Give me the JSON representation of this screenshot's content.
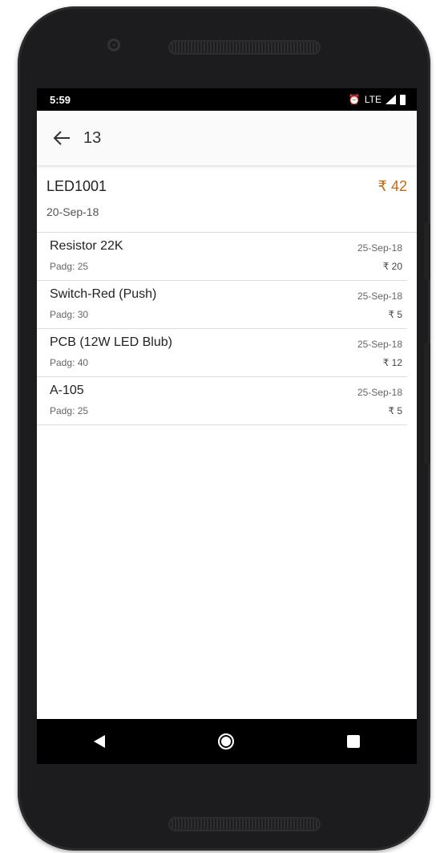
{
  "status_bar": {
    "time": "5:59",
    "network": "LTE"
  },
  "app_bar": {
    "title": "13"
  },
  "order": {
    "code": "LED1001",
    "date": "20-Sep-18",
    "total": "₹ 42"
  },
  "items": [
    {
      "name": "Resistor 22K",
      "padg": "Padg: 25",
      "date": "25-Sep-18",
      "price": "₹ 20"
    },
    {
      "name": "Switch-Red (Push)",
      "padg": "Padg: 30",
      "date": "25-Sep-18",
      "price": "₹ 5"
    },
    {
      "name": "PCB (12W LED Blub)",
      "padg": "Padg: 40",
      "date": "25-Sep-18",
      "price": "₹ 12"
    },
    {
      "name": "A-105",
      "padg": "Padg: 25",
      "date": "25-Sep-18",
      "price": "₹ 5"
    }
  ],
  "colors": {
    "accent": "#c66a12",
    "app_bar_bg": "#fafafa",
    "status_bg": "#000000"
  },
  "icons": {
    "back": "arrow-left-icon",
    "alarm": "alarm-icon",
    "signal": "signal-icon",
    "battery": "battery-icon"
  }
}
